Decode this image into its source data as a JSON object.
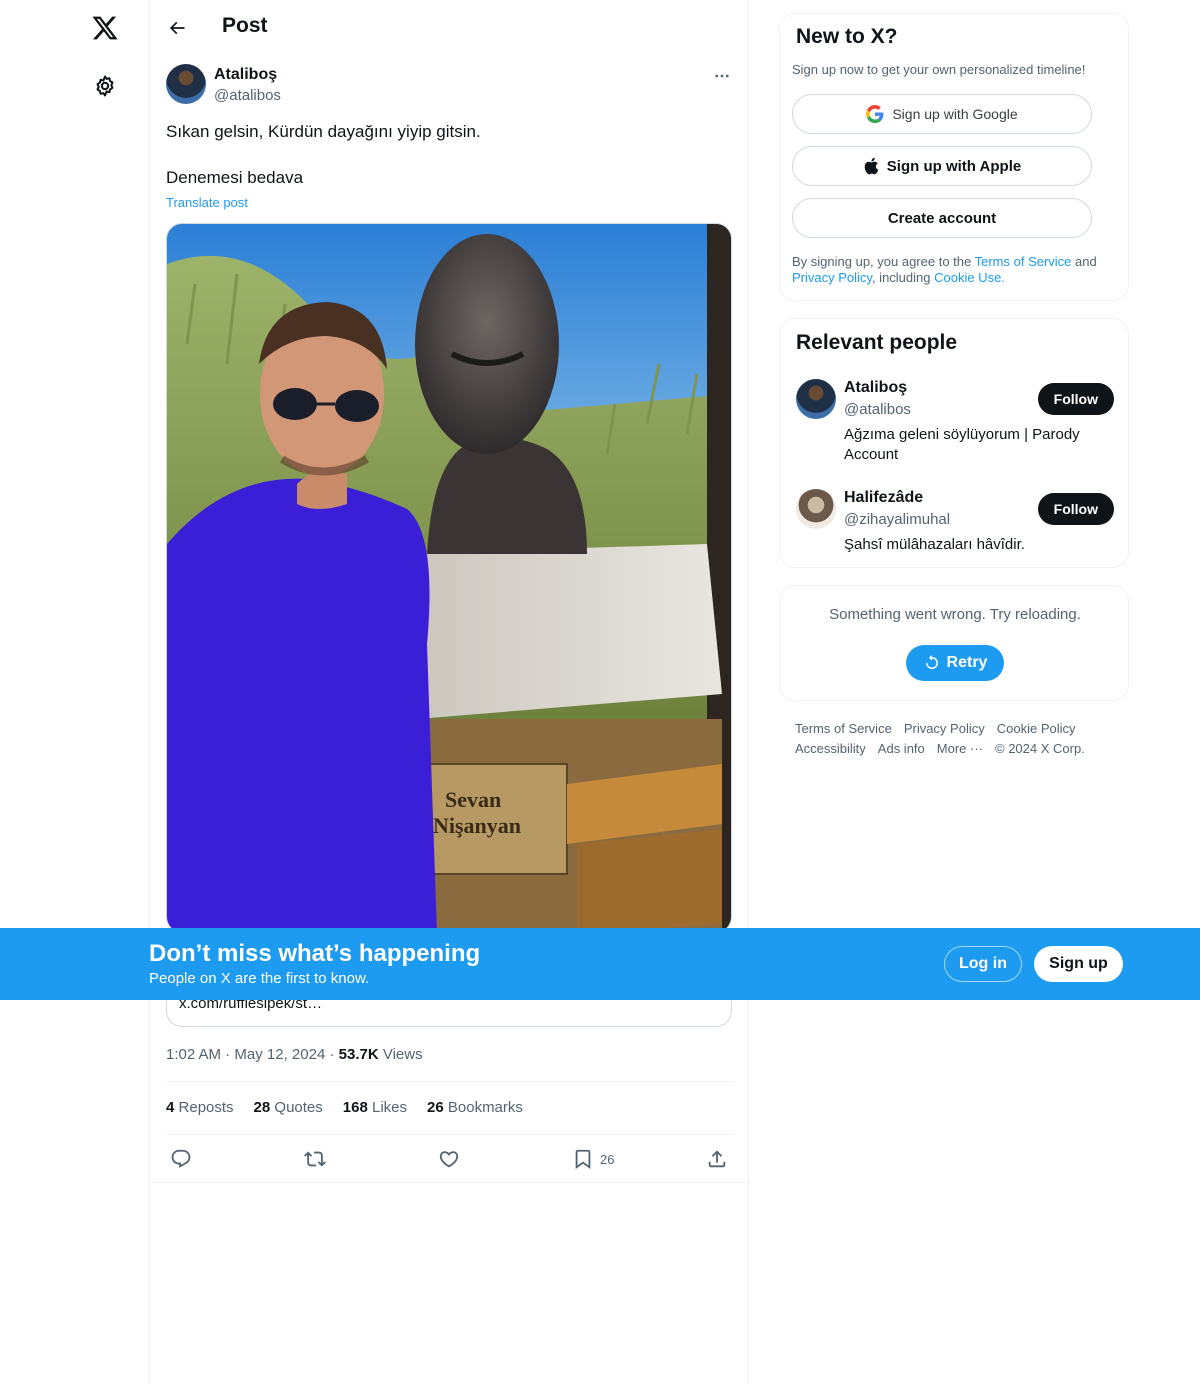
{
  "nav": {
    "logo_icon": "x-logo-icon",
    "settings_icon": "gear-icon"
  },
  "header": {
    "title": "Post",
    "back_icon": "arrow-left-icon"
  },
  "post": {
    "author_name": "Ataliboş",
    "author_handle": "@atalibos",
    "text_line1": "Sıkan gelsin, Kürdün dayağını yiyip gitsin.",
    "text_line2": "Denemesi bedava",
    "translate_label": "Translate post",
    "image_sign_text_1": "Sevan",
    "image_sign_text_2": "Nişanyan",
    "card_url": "x.com/rufflesipek/st…",
    "time": "1:02 AM",
    "date": "May 12, 2024",
    "views_count": "53.7K",
    "views_label": "Views",
    "reposts_count": "4",
    "reposts_label": "Reposts",
    "quotes_count": "28",
    "quotes_label": "Quotes",
    "likes_count": "168",
    "likes_label": "Likes",
    "bookmarks_count": "26",
    "bookmarks_label": "Bookmarks",
    "bookmark_action_count": "26"
  },
  "signup_panel": {
    "title": "New to X?",
    "subtitle": "Sign up now to get your own personalized timeline!",
    "google_label": "Sign up with Google",
    "apple_label": "Sign up with Apple",
    "create_label": "Create account",
    "legal_prefix": "By signing up, you agree to the ",
    "terms": "Terms of Service",
    "and": " and ",
    "privacy": "Privacy Policy",
    "including": ", including ",
    "cookie": "Cookie Use."
  },
  "relevant_people": {
    "title": "Relevant people",
    "people": [
      {
        "name": "Ataliboş",
        "handle": "@atalibos",
        "bio": "Ağzıma geleni söylüyorum | Parody Account",
        "follow_label": "Follow"
      },
      {
        "name": "Halifezâde",
        "handle": "@zihayalimuhal",
        "bio": "Şahsî mülâhazaları hâvîdir.",
        "follow_label": "Follow"
      }
    ]
  },
  "error_panel": {
    "message": "Something went wrong. Try reloading.",
    "retry_label": "Retry"
  },
  "footer": {
    "links": [
      "Terms of Service",
      "Privacy Policy",
      "Cookie Policy",
      "Accessibility",
      "Ads info",
      "More ···",
      "© 2024 X Corp."
    ]
  },
  "banner": {
    "title": "Don’t miss what’s happening",
    "subtitle": "People on X are the first to know.",
    "login_label": "Log in",
    "signup_label": "Sign up"
  },
  "colors": {
    "accent": "#1d9bf0",
    "text": "#0f1419",
    "secondary": "#536471",
    "border": "#eff3f4"
  }
}
